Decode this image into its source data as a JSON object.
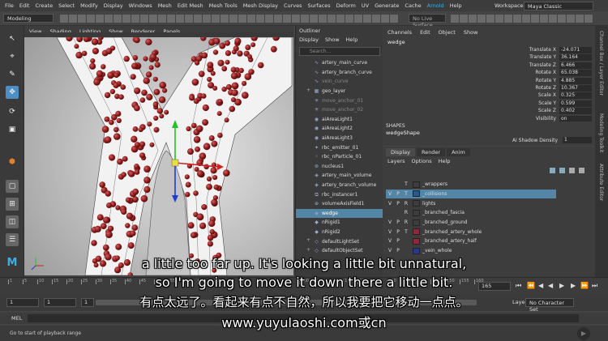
{
  "menubar": {
    "items": [
      "File",
      "Edit",
      "Create",
      "Select",
      "Modify",
      "Display",
      "Windows",
      "Mesh",
      "Edit Mesh",
      "Mesh Tools",
      "Mesh Display",
      "Curves",
      "Surfaces",
      "Deform",
      "UV",
      "Generate",
      "Cache",
      "Arnold",
      "Help"
    ],
    "workspace_label": "Workspace :",
    "workspace_value": "Maya Classic"
  },
  "statusline": {
    "mode": "Modeling",
    "live_surface": "No Live Surface"
  },
  "viewport": {
    "menu": [
      "View",
      "Shading",
      "Lighting",
      "Show",
      "Renderer",
      "Panels"
    ]
  },
  "outliner": {
    "title": "Outliner",
    "menu": [
      "Display",
      "Show",
      "Help"
    ],
    "search_placeholder": "Search...",
    "items": [
      {
        "label": "artery_main_curve",
        "icon": "curve-icon",
        "dim": false,
        "plus": false,
        "sel": false
      },
      {
        "label": "artery_branch_curve",
        "icon": "curve-icon",
        "dim": false,
        "plus": false,
        "sel": false
      },
      {
        "label": "vein_curve",
        "icon": "curve-icon",
        "dim": true,
        "plus": false,
        "sel": false
      },
      {
        "label": "geo_layer",
        "icon": "group-icon",
        "dim": false,
        "plus": true,
        "sel": false
      },
      {
        "label": "move_anchor_01",
        "icon": "locator-icon",
        "dim": true,
        "plus": false,
        "sel": false
      },
      {
        "label": "move_anchor_02",
        "icon": "locator-icon",
        "dim": true,
        "plus": false,
        "sel": false
      },
      {
        "label": "aiAreaLight1",
        "icon": "light-icon",
        "dim": false,
        "plus": false,
        "sel": false
      },
      {
        "label": "aiAreaLight2",
        "icon": "light-icon",
        "dim": false,
        "plus": false,
        "sel": false
      },
      {
        "label": "aiAreaLight3",
        "icon": "light-icon",
        "dim": false,
        "plus": false,
        "sel": false
      },
      {
        "label": "rbc_emitter_01",
        "icon": "emitter-icon",
        "dim": false,
        "plus": false,
        "sel": false
      },
      {
        "label": "rbc_nParticle_01",
        "icon": "particle-icon",
        "dim": false,
        "plus": false,
        "sel": false
      },
      {
        "label": "nucleus1",
        "icon": "nucleus-icon",
        "dim": false,
        "plus": false,
        "sel": false
      },
      {
        "label": "artery_main_volume",
        "icon": "mesh-icon",
        "dim": false,
        "plus": false,
        "sel": false
      },
      {
        "label": "artery_branch_volume",
        "icon": "mesh-icon",
        "dim": false,
        "plus": false,
        "sel": false
      },
      {
        "label": "rbc_instancer1",
        "icon": "instancer-icon",
        "dim": false,
        "plus": false,
        "sel": false
      },
      {
        "label": "volumeAxisField1",
        "icon": "field-icon",
        "dim": false,
        "plus": false,
        "sel": false
      },
      {
        "label": "wedge",
        "icon": "mesh-icon",
        "dim": false,
        "plus": false,
        "sel": true
      },
      {
        "label": "nRigid1",
        "icon": "rigid-icon",
        "dim": false,
        "plus": false,
        "sel": false
      },
      {
        "label": "nRigid2",
        "icon": "rigid-icon",
        "dim": false,
        "plus": false,
        "sel": false
      },
      {
        "label": "defaultLightSet",
        "icon": "set-icon",
        "dim": false,
        "plus": true,
        "sel": false
      },
      {
        "label": "defaultObjectSet",
        "icon": "set-icon",
        "dim": false,
        "plus": true,
        "sel": false
      }
    ]
  },
  "channelbox": {
    "menu": [
      "Channels",
      "Edit",
      "Object",
      "Show"
    ],
    "object_name": "wedge",
    "attributes": [
      {
        "label": "Translate X",
        "value": "-24.071"
      },
      {
        "label": "Translate Y",
        "value": "36.164"
      },
      {
        "label": "Translate Z",
        "value": "6.466"
      },
      {
        "label": "Rotate X",
        "value": "65.038"
      },
      {
        "label": "Rotate Y",
        "value": "4.885"
      },
      {
        "label": "Rotate Z",
        "value": "10.367"
      },
      {
        "label": "Scale X",
        "value": "0.325"
      },
      {
        "label": "Scale Y",
        "value": "0.599"
      },
      {
        "label": "Scale Z",
        "value": "0.402"
      },
      {
        "label": "Visibility",
        "value": "on"
      }
    ],
    "shapes_label": "SHAPES",
    "shape_name": "wedgeShape",
    "shadow_label": "Ai Shadow Density",
    "shadow_value": "1"
  },
  "layereditor": {
    "tabs": [
      "Display",
      "Render",
      "Anim"
    ],
    "menu": [
      "Layers",
      "Options",
      "Help"
    ],
    "rows": [
      {
        "v": "",
        "p": "",
        "t": "T",
        "color": "#3d3d3d",
        "name": "_wrappers",
        "sel": false
      },
      {
        "v": "V",
        "p": "P",
        "t": "T",
        "color": "#2a5a8a",
        "name": "_collisions",
        "sel": true
      },
      {
        "v": "V",
        "p": "P",
        "t": "R",
        "color": "#3d3d3d",
        "name": "lights",
        "sel": false
      },
      {
        "v": "",
        "p": "",
        "t": "R",
        "color": "#3d3d3d",
        "name": "_branched_fascia",
        "sel": false
      },
      {
        "v": "V",
        "p": "P",
        "t": "R",
        "color": "#3d3d3d",
        "name": "_branched_ground",
        "sel": false
      },
      {
        "v": "V",
        "p": "P",
        "t": "T",
        "color": "#8a2a3a",
        "name": "_branched_artery_whole",
        "sel": false
      },
      {
        "v": "V",
        "p": "P",
        "t": "",
        "color": "#8a2a3a",
        "name": "_branched_artery_half",
        "sel": false
      },
      {
        "v": "V",
        "p": "P",
        "t": "",
        "color": "#2a3a8a",
        "name": "_vein_whole",
        "sel": false
      }
    ]
  },
  "timeline": {
    "ticks": [
      "1",
      "5",
      "10",
      "15",
      "20",
      "25",
      "30",
      "35",
      "40",
      "45",
      "50",
      "55",
      "60",
      "65",
      "70",
      "75",
      "80",
      "85",
      "90",
      "95",
      "100",
      "105",
      "110",
      "115",
      "120",
      "125",
      "130",
      "135",
      "140",
      "145",
      "150",
      "155",
      "160"
    ],
    "current_frame": "165",
    "range_start": "1",
    "range_start2": "1",
    "range_box": "1",
    "character_set": "No Character Set",
    "anim_layer": "Layer"
  },
  "mel_label": "MEL",
  "help_text": "Go to start of playback range",
  "right_tabs": [
    "Channel Box / Layer Editor",
    "Modeling Toolkit",
    "Attribute Editor"
  ],
  "subtitles": {
    "line1": "a little too far up. It's looking a little bit unnatural,",
    "line2": "so I'm going to move it down there a little bit.",
    "line3": "有点太远了。看起来有点不自然，所以我要把它移动一点点。",
    "line4": "www.yuyulaoshi.com或cn"
  },
  "colors": {
    "selection": "#5285a6",
    "cells": "#8b1a1a",
    "accent": "#3cb0e0"
  }
}
